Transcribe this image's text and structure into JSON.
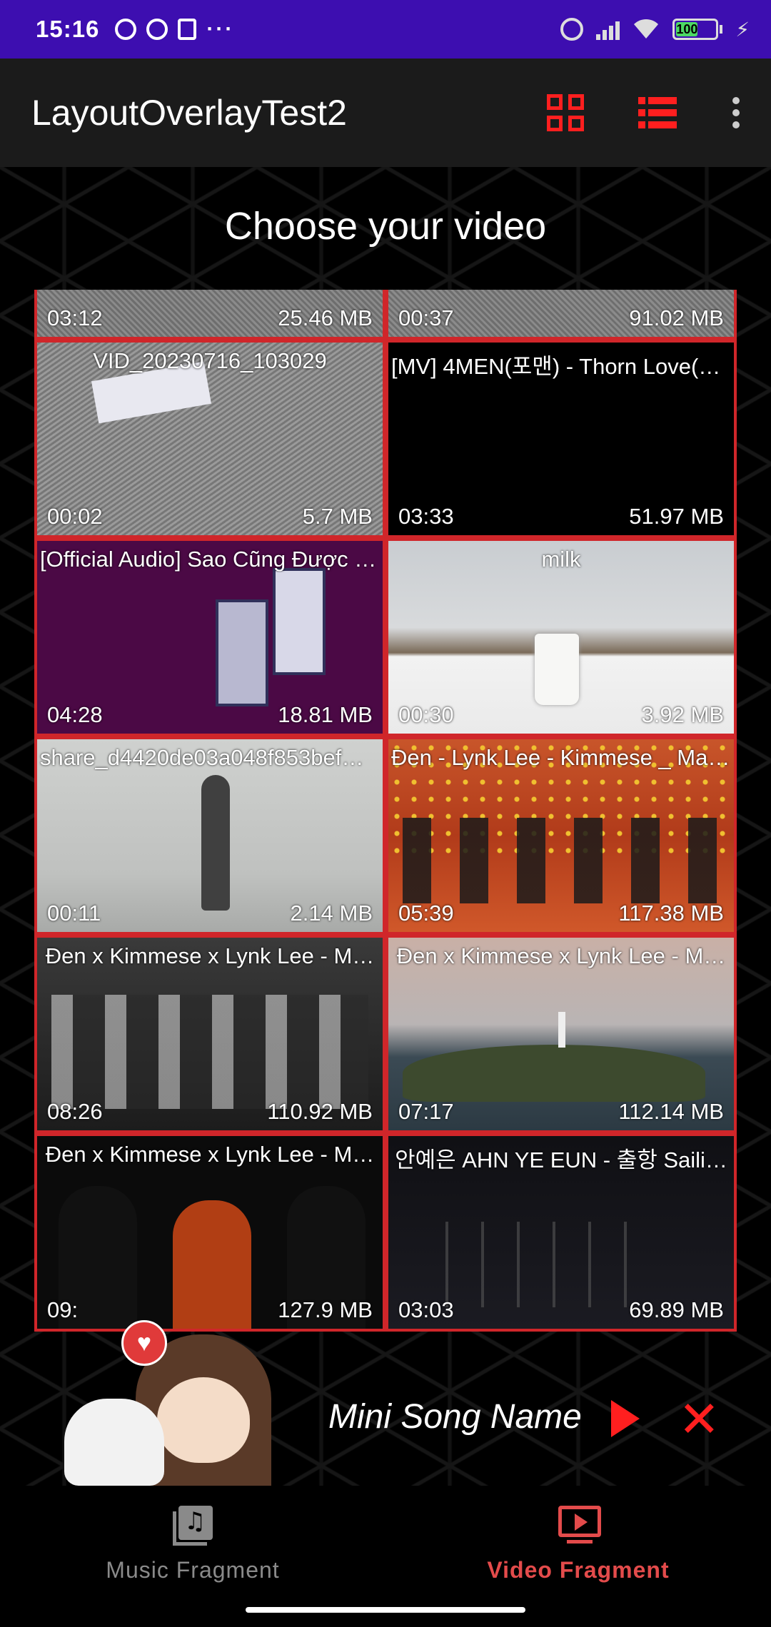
{
  "status_bar": {
    "time": "15:16",
    "dots": "···",
    "battery": "100",
    "bolt": "⚡"
  },
  "app_bar": {
    "title": "LayoutOverlayTest2"
  },
  "heading": "Choose your video",
  "videos": [
    {
      "title": "",
      "duration": "03:12",
      "size": "25.46 MB"
    },
    {
      "title": "",
      "duration": "00:37",
      "size": "91.02 MB"
    },
    {
      "title": "VID_20230716_103029",
      "duration": "00:02",
      "size": "5.7 MB"
    },
    {
      "title": "[MV] 4MEN(포맨) - Thorn Love(…",
      "duration": "03:33",
      "size": "51.97 MB"
    },
    {
      "title": "[Official Audio] Sao Cũng Được …",
      "duration": "04:28",
      "size": "18.81 MB"
    },
    {
      "title": "milk",
      "duration": "00:30",
      "size": "3.92 MB"
    },
    {
      "title": "share_d4420de03a048f853bef…",
      "duration": "00:11",
      "size": "2.14 MB"
    },
    {
      "title": "Đen - Lynk Lee - Kimmese _ Ma…",
      "duration": "05:39",
      "size": "117.38 MB"
    },
    {
      "title": "Đen x Kimmese x Lynk Lee - M…",
      "duration": "08:26",
      "size": "110.92 MB"
    },
    {
      "title": "Đen x Kimmese x Lynk Lee - M…",
      "duration": "07:17",
      "size": "112.14 MB"
    },
    {
      "title": "Đen x Kimmese x Lynk Lee - M…",
      "duration": "09:",
      "size": "127.9 MB"
    },
    {
      "title": "안예은 AHN YE EUN - 출항 Saili…",
      "duration": "03:03",
      "size": "69.89 MB"
    }
  ],
  "mini_player": {
    "song_name": "Mini Song Name",
    "heart": "♥",
    "close": "✕"
  },
  "bottom_nav": [
    {
      "label": "Music Fragment",
      "active": false
    },
    {
      "label": "Video Fragment",
      "active": true
    }
  ],
  "colors": {
    "accent": "#ff1f1f",
    "status_bar": "#3d0eb0",
    "app_bar": "#1b1b1b",
    "card_border": "#d0262a"
  }
}
